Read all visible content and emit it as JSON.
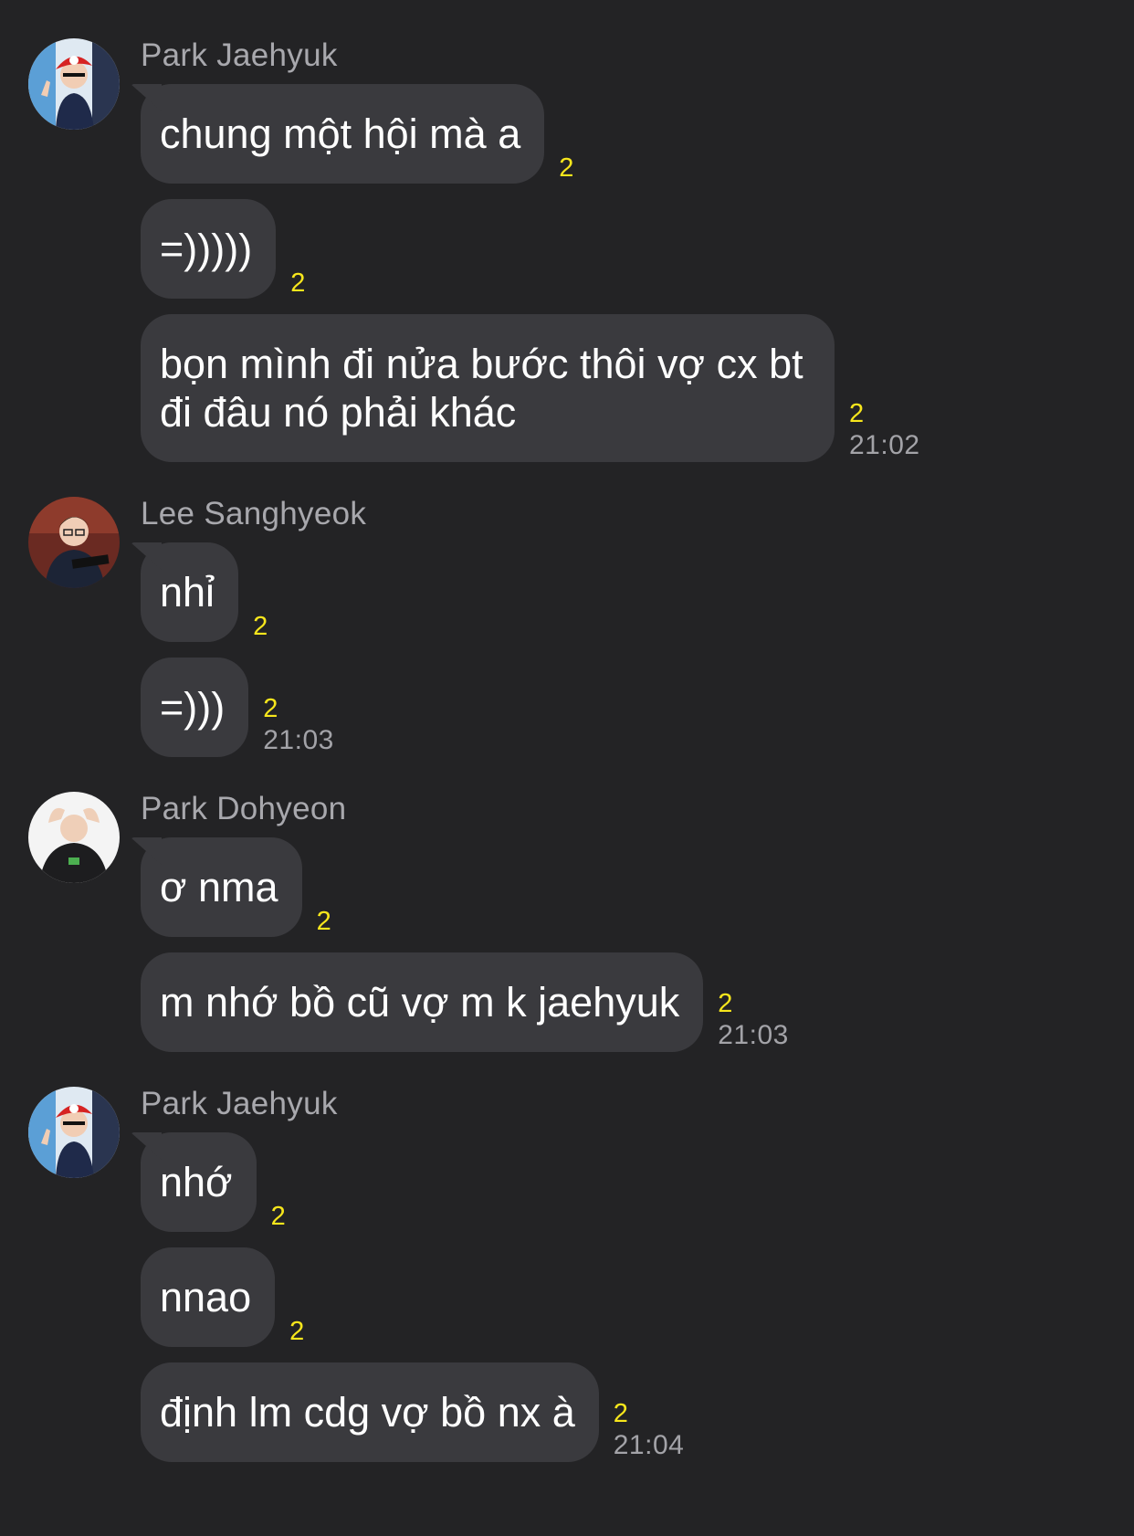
{
  "colors": {
    "background": "#232325",
    "bubble": "#3a3a3e",
    "unread_count": "#f7e61c",
    "sender_name": "#a8a8ad"
  },
  "groups": [
    {
      "sender": "Park Jaehyuk",
      "avatar": "avatar-photo",
      "messages": [
        {
          "text": "chung một hội mà a",
          "count": "2"
        },
        {
          "text": "=)))))",
          "count": "2"
        },
        {
          "text": "bọn mình đi nửa bước thôi vợ cx bt đi đâu nó phải khác",
          "count": "2",
          "time": "21:02"
        }
      ]
    },
    {
      "sender": "Lee Sanghyeok",
      "avatar": "avatar-photo",
      "messages": [
        {
          "text": "nhỉ",
          "count": "2"
        },
        {
          "text": "=)))",
          "count": "2",
          "time": "21:03"
        }
      ]
    },
    {
      "sender": "Park Dohyeon",
      "avatar": "avatar-photo",
      "messages": [
        {
          "text": "ơ nma",
          "count": "2"
        },
        {
          "text": "m nhớ bồ cũ vợ m k jaehyuk",
          "count": "2",
          "time": "21:03"
        }
      ]
    },
    {
      "sender": "Park Jaehyuk",
      "avatar": "avatar-photo",
      "messages": [
        {
          "text": "nhớ",
          "count": "2"
        },
        {
          "text": "nnao",
          "count": "2"
        },
        {
          "text": "định lm cdg vợ bồ nx à",
          "count": "2",
          "time": "21:04"
        }
      ]
    }
  ]
}
